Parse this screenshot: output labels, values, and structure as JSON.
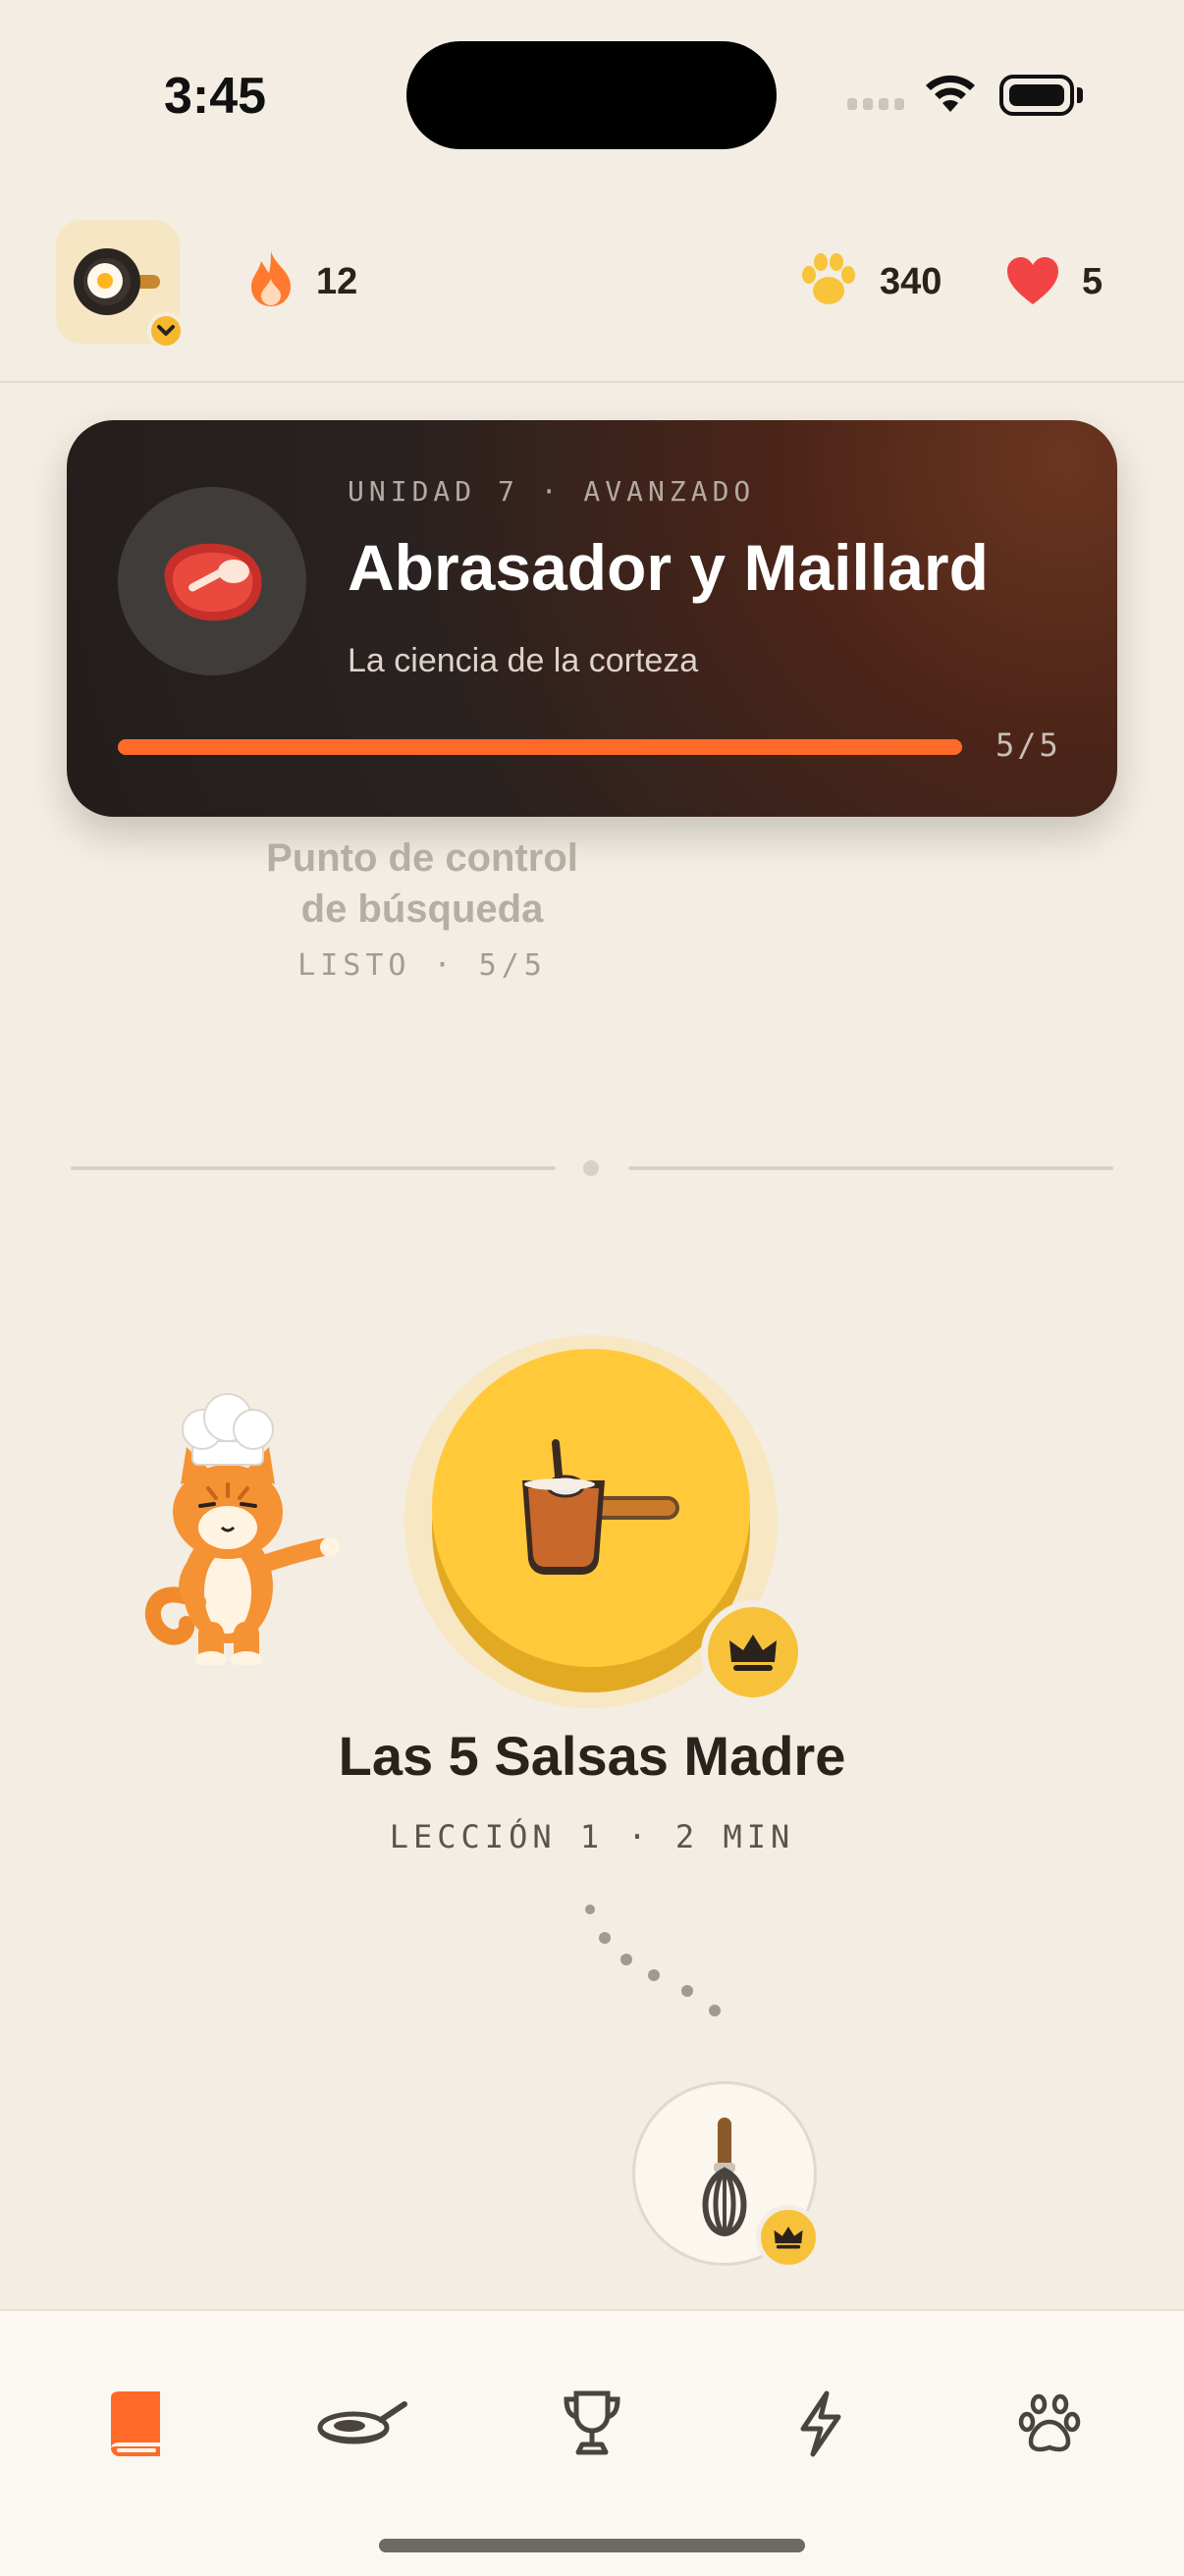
{
  "status_bar": {
    "time": "3:45"
  },
  "header": {
    "streak_count": "12",
    "paws_count": "340",
    "hearts_count": "5"
  },
  "unit_card": {
    "kicker": "UNIDAD 7 · AVANZADO",
    "title": "Abrasador y Maillard",
    "subtitle": "La ciencia de la corteza",
    "progress_label": "5/5",
    "progress_fraction": 1.0
  },
  "checkpoint": {
    "title_line1": "Punto de control",
    "title_line2": "de búsqueda",
    "status": "LISTO · 5/5"
  },
  "lesson": {
    "title": "Las 5 Salsas Madre",
    "meta": "LECCIÓN 1 · 2 MIN"
  },
  "tabs": [
    {
      "name": "learn",
      "icon": "book-icon",
      "active": true
    },
    {
      "name": "cook",
      "icon": "pan-icon",
      "active": false
    },
    {
      "name": "leaderboard",
      "icon": "trophy-icon",
      "active": false
    },
    {
      "name": "practice",
      "icon": "bolt-icon",
      "active": false
    },
    {
      "name": "profile",
      "icon": "paw-icon",
      "active": false
    }
  ],
  "colors": {
    "background": "#f3ede3",
    "accent_orange": "#ff6a28",
    "lesson_yellow": "#ffc93a",
    "heart_red": "#f24444",
    "paw_yellow": "#f7c43a"
  }
}
